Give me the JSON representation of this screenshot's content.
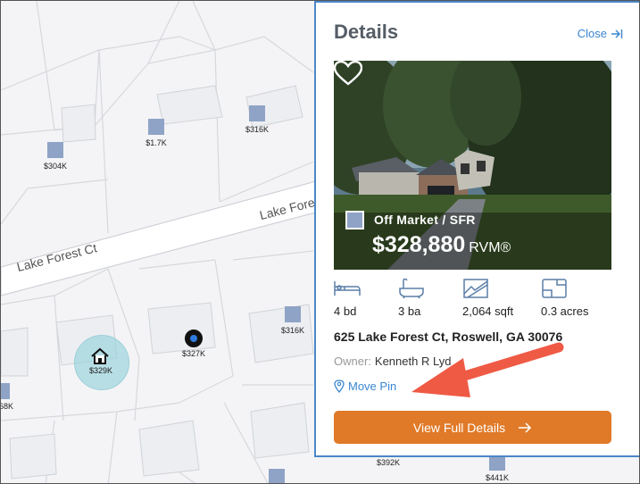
{
  "map": {
    "streets": [
      {
        "name": "Lake Forest Ct"
      },
      {
        "name": "Lake Forest Ct"
      }
    ],
    "pins": [
      {
        "label": "$304K"
      },
      {
        "label": "$1.7K"
      },
      {
        "label": "$316K"
      },
      {
        "label": "$316K"
      },
      {
        "label": "$327K"
      },
      {
        "label": "$329K"
      },
      {
        "label": "68K"
      },
      {
        "label": "$392K"
      },
      {
        "label": "$441K"
      }
    ]
  },
  "panel": {
    "title": "Details",
    "close_label": "Close",
    "photo": {
      "status": "Off Market / SFR",
      "price": "$328,880",
      "price_suffix": "RVM®",
      "favorite_icon": "heart-icon"
    },
    "stats": [
      {
        "icon": "bed-icon",
        "label": "4 bd"
      },
      {
        "icon": "bath-icon",
        "label": "3 ba"
      },
      {
        "icon": "sqft-icon",
        "label": "2,064 sqft"
      },
      {
        "icon": "lot-icon",
        "label": "0.3 acres"
      }
    ],
    "address": "625 Lake Forest Ct, Roswell, GA 30076",
    "owner_label": "Owner:",
    "owner_name": "Kenneth R Lyd",
    "move_pin_label": "Move Pin",
    "full_details_label": "View Full Details"
  },
  "colors": {
    "accent_blue": "#3a86d0",
    "panel_border": "#4a87c9",
    "button_orange": "#e07a28",
    "pin_color": "#8fa3c6",
    "annotation_arrow": "#ef5a45"
  }
}
